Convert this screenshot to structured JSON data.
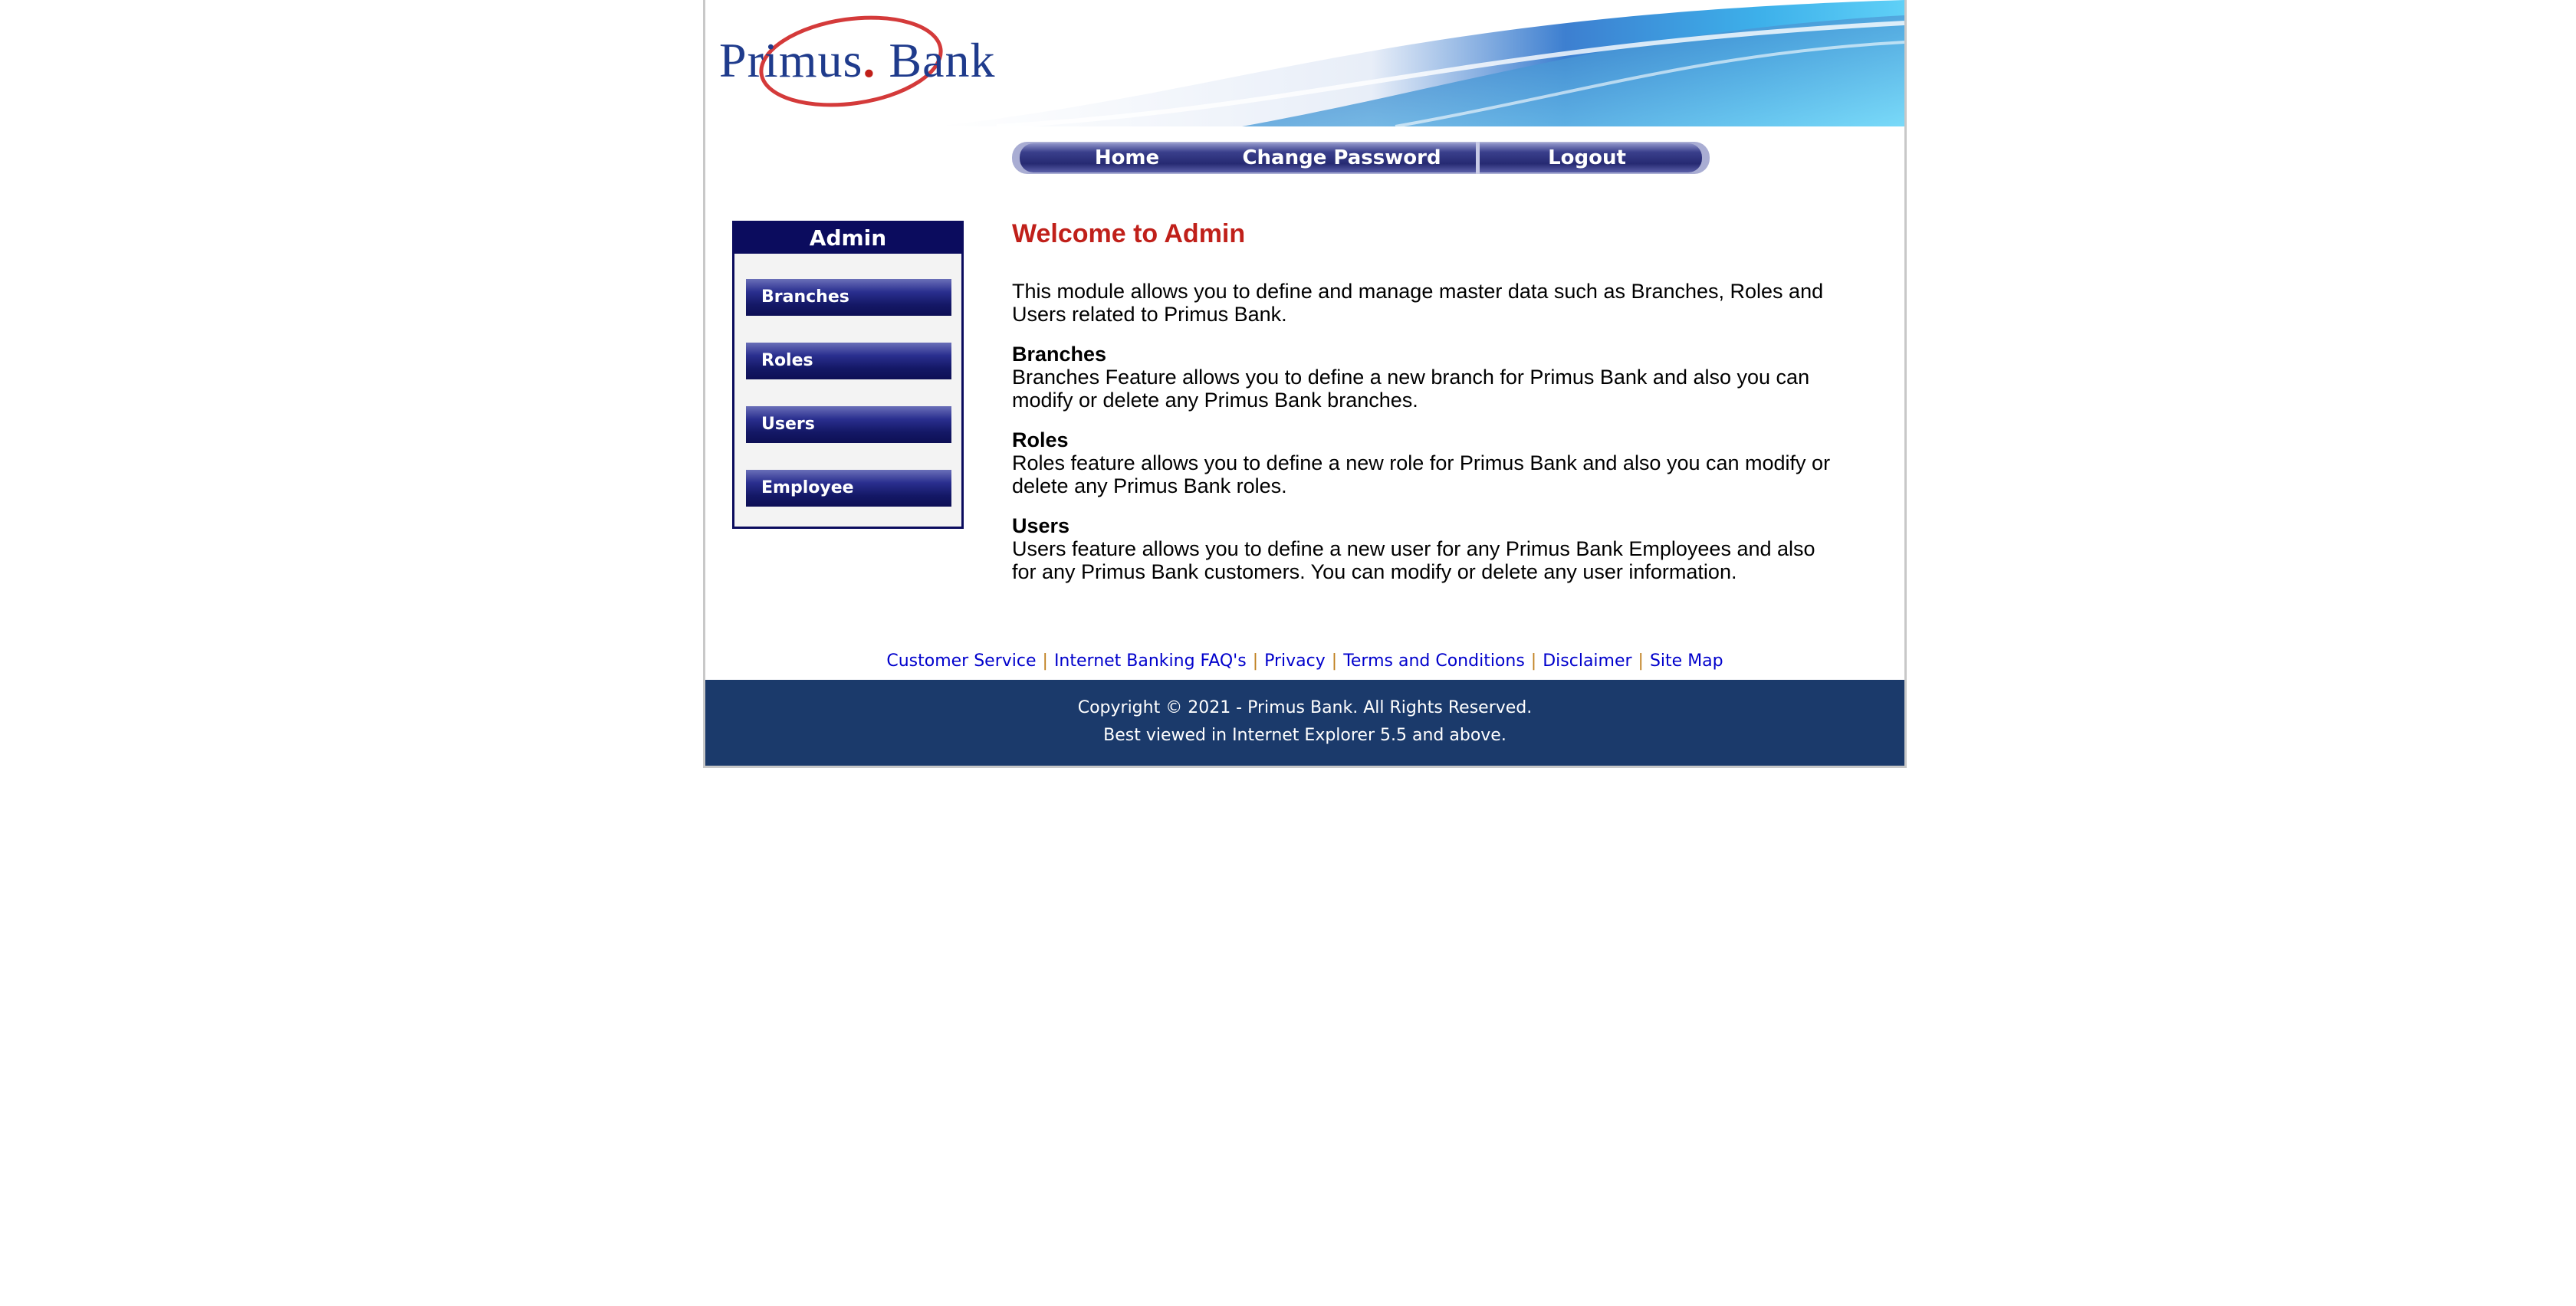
{
  "logo": {
    "text_primus": "Primus",
    "text_dot": ".",
    "text_bank": " Bank"
  },
  "nav": {
    "items": [
      {
        "label": "Home"
      },
      {
        "label": "Change Password"
      },
      {
        "label": "Logout"
      }
    ]
  },
  "sidebar": {
    "title": "Admin",
    "items": [
      {
        "label": "Branches"
      },
      {
        "label": "Roles"
      },
      {
        "label": "Users"
      },
      {
        "label": "Employee"
      }
    ]
  },
  "main": {
    "title": "Welcome to Admin",
    "intro": "This module allows you to define and manage master data such as Branches, Roles and Users related to Primus Bank.",
    "sections": [
      {
        "title": "Branches",
        "text": "Branches Feature allows you to define a new branch for Primus Bank and also you can modify or delete any Primus Bank branches."
      },
      {
        "title": "Roles",
        "text": "Roles feature allows you to define a new role for Primus Bank and also you can modify or delete any Primus Bank roles."
      },
      {
        "title": "Users",
        "text": "Users feature allows you to define a new user for any Primus Bank Employees and also for any Primus Bank customers. You can modify or delete any user information."
      }
    ]
  },
  "footer": {
    "links": [
      {
        "label": "Customer Service"
      },
      {
        "label": "Internet Banking FAQ's"
      },
      {
        "label": "Privacy"
      },
      {
        "label": "Terms and Conditions"
      },
      {
        "label": "Disclaimer"
      },
      {
        "label": "Site Map"
      }
    ],
    "separator": "|",
    "copyright": "Copyright © 2021 - Primus Bank. All Rights Reserved.",
    "browser_note": "Best viewed in Internet Explorer 5.5 and above."
  },
  "colors": {
    "nav_blue": "#2a2f7a",
    "sidebar_dark": "#0b0c5e",
    "title_red": "#c0201a",
    "footer_band": "#1b3a6b",
    "link_blue": "#0000cc"
  }
}
